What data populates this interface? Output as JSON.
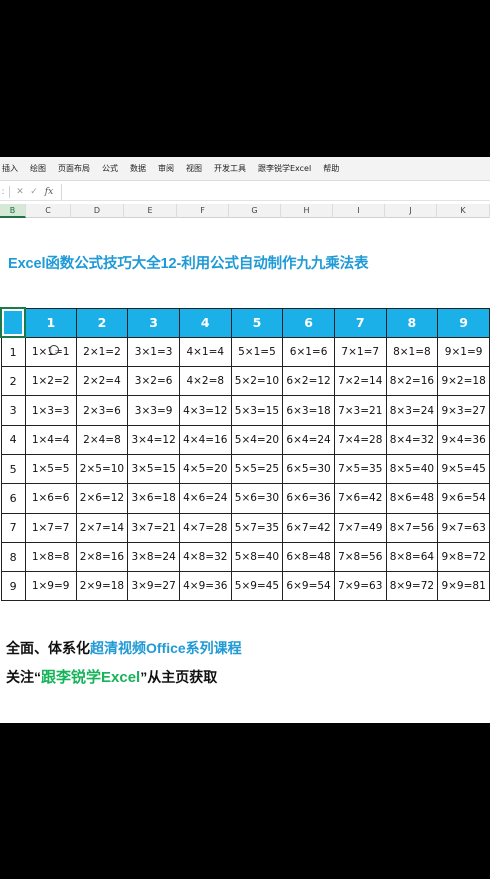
{
  "ribbon": {
    "tabs": [
      "插入",
      "绘图",
      "页面布局",
      "公式",
      "数据",
      "审阅",
      "视图",
      "开发工具",
      "跟李锐学Excel",
      "帮助"
    ]
  },
  "formula_bar": {
    "cancel_icon": "close-icon",
    "confirm_icon": "check-icon",
    "fx_label": "fx",
    "value": ""
  },
  "columns": {
    "headers": [
      "B",
      "C",
      "D",
      "E",
      "F",
      "G",
      "H",
      "I",
      "J",
      "K"
    ],
    "selected": "B"
  },
  "sheet": {
    "title": "Excel函数公式技巧大全12-利用公式自动制作九九乘法表",
    "table": {
      "col_headers": [
        "1",
        "2",
        "3",
        "4",
        "5",
        "6",
        "7",
        "8",
        "9"
      ],
      "rows": [
        {
          "label": "1",
          "cells": [
            "1×1=1",
            "2×1=2",
            "3×1=3",
            "4×1=4",
            "5×1=5",
            "6×1=6",
            "7×1=7",
            "8×1=8",
            "9×1=9"
          ]
        },
        {
          "label": "2",
          "cells": [
            "1×2=2",
            "2×2=4",
            "3×2=6",
            "4×2=8",
            "5×2=10",
            "6×2=12",
            "7×2=14",
            "8×2=16",
            "9×2=18"
          ]
        },
        {
          "label": "3",
          "cells": [
            "1×3=3",
            "2×3=6",
            "3×3=9",
            "4×3=12",
            "5×3=15",
            "6×3=18",
            "7×3=21",
            "8×3=24",
            "9×3=27"
          ]
        },
        {
          "label": "4",
          "cells": [
            "1×4=4",
            "2×4=8",
            "3×4=12",
            "4×4=16",
            "5×4=20",
            "6×4=24",
            "7×4=28",
            "8×4=32",
            "9×4=36"
          ]
        },
        {
          "label": "5",
          "cells": [
            "1×5=5",
            "2×5=10",
            "3×5=15",
            "4×5=20",
            "5×5=25",
            "6×5=30",
            "7×5=35",
            "8×5=40",
            "9×5=45"
          ]
        },
        {
          "label": "6",
          "cells": [
            "1×6=6",
            "2×6=12",
            "3×6=18",
            "4×6=24",
            "5×6=30",
            "6×6=36",
            "7×6=42",
            "8×6=48",
            "9×6=54"
          ]
        },
        {
          "label": "7",
          "cells": [
            "1×7=7",
            "2×7=14",
            "3×7=21",
            "4×7=28",
            "5×7=35",
            "6×7=42",
            "7×7=49",
            "8×7=56",
            "9×7=63"
          ]
        },
        {
          "label": "8",
          "cells": [
            "1×8=8",
            "2×8=16",
            "3×8=24",
            "4×8=32",
            "5×8=40",
            "6×8=48",
            "7×8=56",
            "8×8=64",
            "9×8=72"
          ]
        },
        {
          "label": "9",
          "cells": [
            "1×9=9",
            "2×9=18",
            "3×9=27",
            "4×9=36",
            "5×9=45",
            "6×9=54",
            "7×9=63",
            "8×9=72",
            "9×9=81"
          ]
        }
      ]
    }
  },
  "footer": {
    "line1_prefix": "全面、体系化",
    "line1_highlight": "超清视频Office系列课程",
    "line2_prefix": "关注“",
    "line2_highlight": "跟李锐学Excel",
    "line2_suffix": "”从主页获取"
  },
  "colors": {
    "accent_blue": "#1bb0e7",
    "title_blue": "#1f9ad6",
    "highlight_green": "#17b35a",
    "excel_green": "#217346"
  }
}
